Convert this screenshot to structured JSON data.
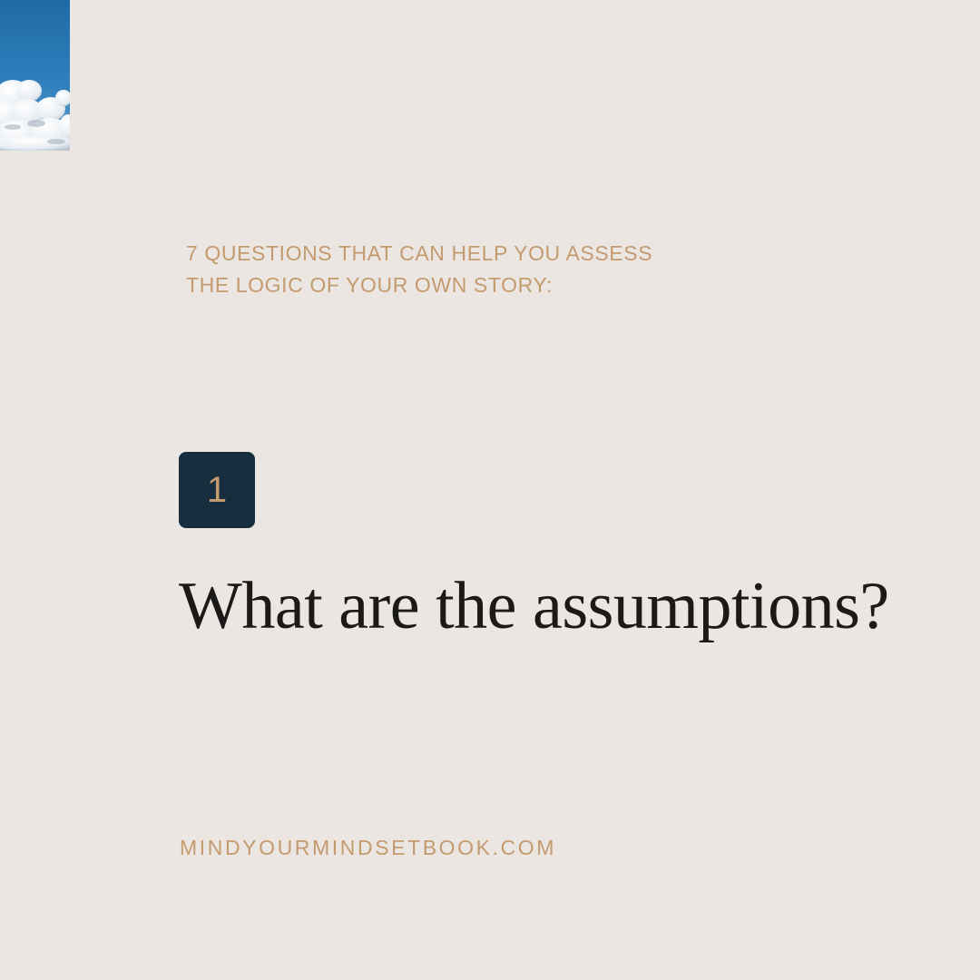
{
  "intro": {
    "line1": "7 QUESTIONS THAT CAN HELP YOU ASSESS",
    "line2": "THE LOGIC OF YOUR OWN STORY:"
  },
  "badge": {
    "number": "1"
  },
  "question": "What are the assumptions?",
  "website": "MINDYOURMINDSETBOOK.COM",
  "colors": {
    "background": "#ebe6e2",
    "accent": "#c49b6f",
    "badge": "#162e3e",
    "text": "#1c1a19",
    "sky": "#2a77b1"
  },
  "images": {
    "corner": "sky-with-clouds-photo"
  }
}
